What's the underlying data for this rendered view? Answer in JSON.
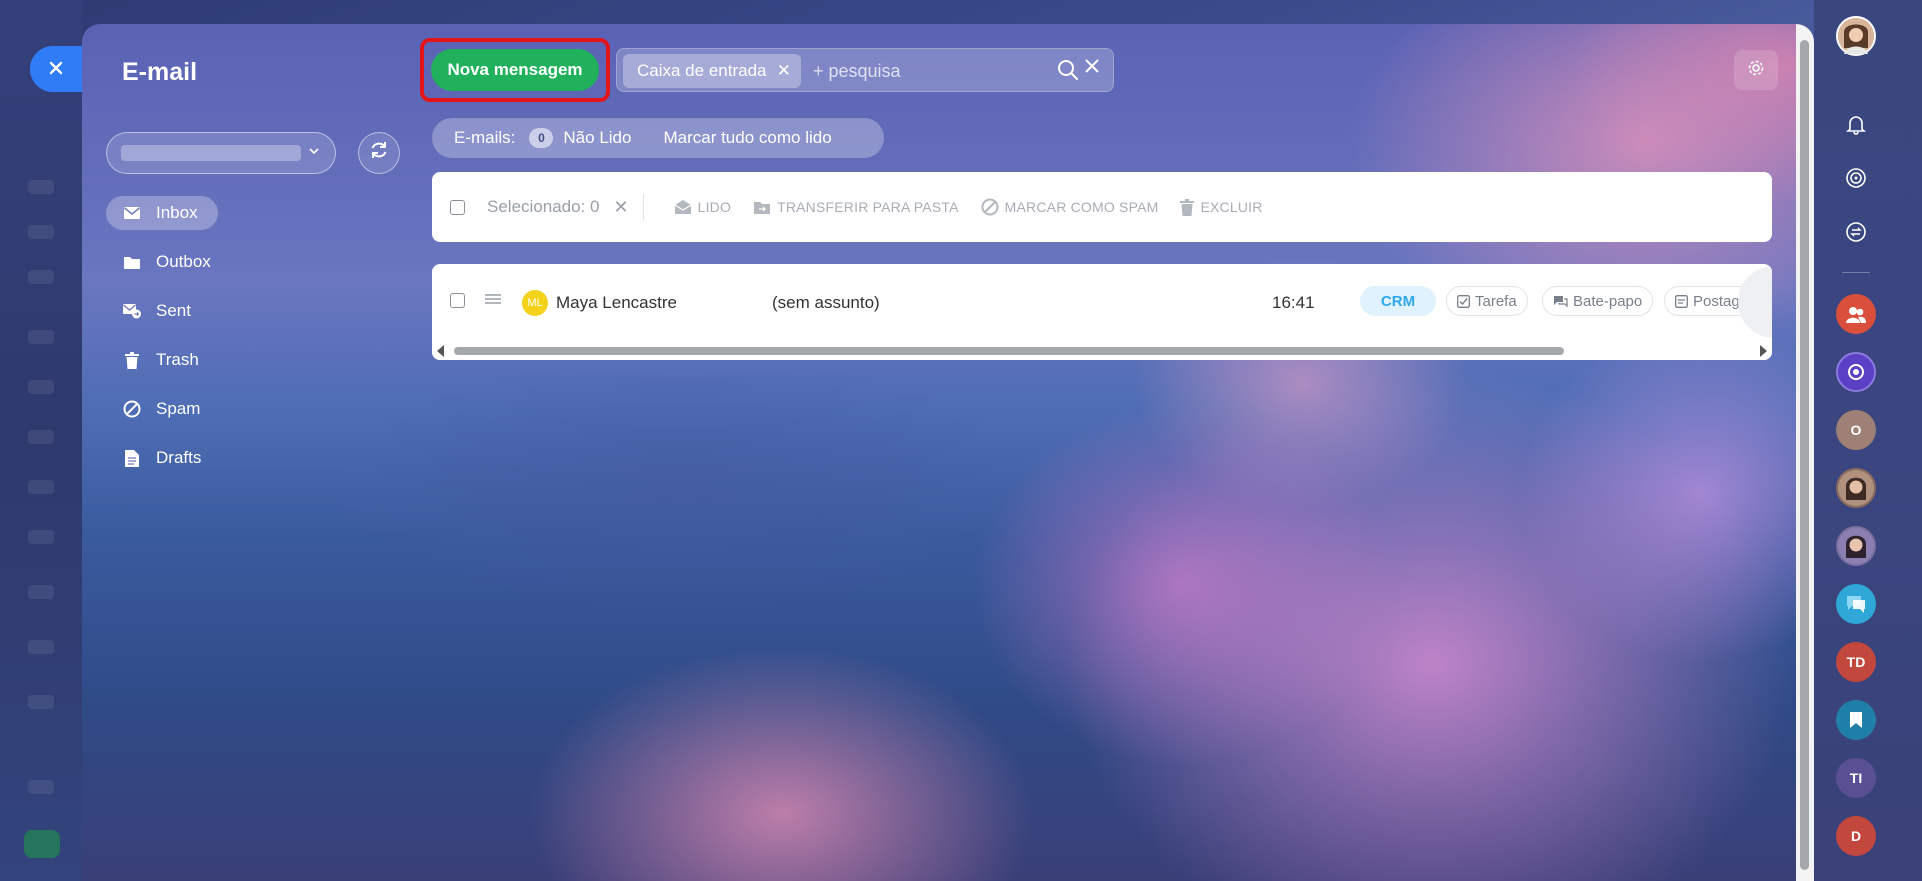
{
  "app": {
    "title": "E-mail",
    "close_icon": "close-icon"
  },
  "sidebar": {
    "folders": [
      {
        "label": "Inbox",
        "icon": "envelope-icon",
        "active": true
      },
      {
        "label": "Outbox",
        "icon": "folder-icon",
        "active": false
      },
      {
        "label": "Sent",
        "icon": "sent-icon",
        "active": false
      },
      {
        "label": "Trash",
        "icon": "trash-icon",
        "active": false
      },
      {
        "label": "Spam",
        "icon": "ban-icon",
        "active": false
      },
      {
        "label": "Drafts",
        "icon": "document-icon",
        "active": false
      }
    ]
  },
  "toolbar": {
    "new_message_label": "Nova mensagem",
    "search": {
      "filter_chip": "Caixa de entrada",
      "placeholder": "+ pesquisa"
    }
  },
  "counters": {
    "emails_label": "E-mails:",
    "unread_count": "0",
    "unread_label": "Não Lido",
    "mark_all_label": "Marcar tudo como lido"
  },
  "actions": {
    "selected_label": "Selecionado: 0",
    "read": "LIDO",
    "move_to_folder": "TRANSFERIR PARA PASTA",
    "mark_spam": "MARCAR COMO SPAM",
    "delete": "EXCLUIR"
  },
  "messages": [
    {
      "avatar_initials": "ML",
      "from": "Maya Lencastre",
      "subject": "(sem assunto)",
      "time": "16:41",
      "crm": "CRM",
      "task": "Tarefa",
      "chat": "Bate-papo",
      "post": "Postagem d"
    }
  ],
  "rail": {
    "avatars": [
      "O",
      "TD",
      "TI",
      "D"
    ]
  },
  "colors": {
    "accent_blue": "#2f7cf6",
    "new_message_green": "#21b05c",
    "highlight_red": "#e3151a",
    "crm_blue": "#2fa8e8",
    "avatar_yellow": "#f4d11a"
  }
}
